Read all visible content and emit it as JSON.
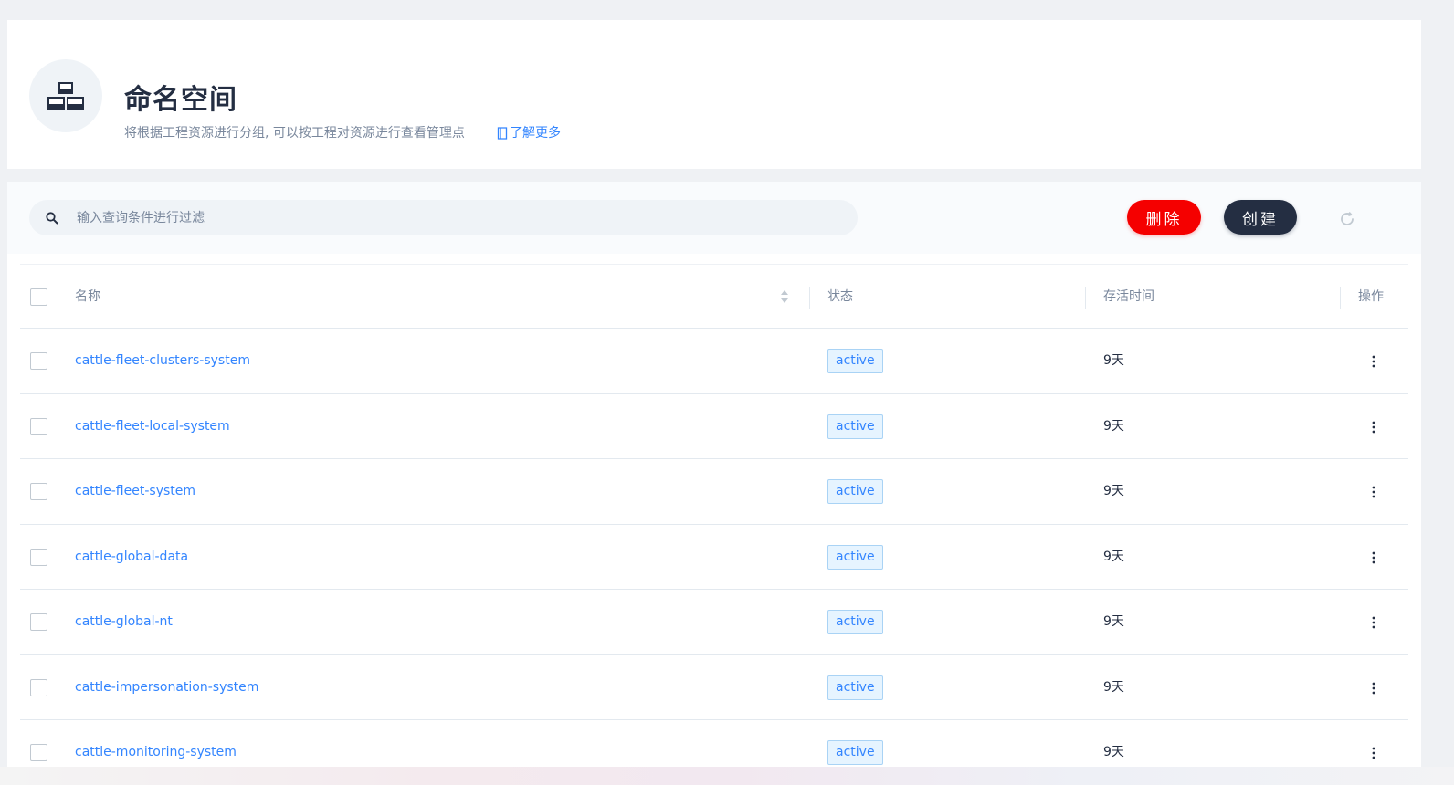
{
  "header": {
    "title": "命名空间",
    "description": "将根据工程资源进行分组, 可以按工程对资源进行查看管理点",
    "learn_more": "了解更多",
    "icon": "namespace-icon"
  },
  "toolbar": {
    "search_placeholder": "输入查询条件进行过滤",
    "delete_label": "删除",
    "create_label": "创建",
    "delete_color": "#f50000",
    "create_color": "#242e42"
  },
  "table": {
    "columns": {
      "name": "名称",
      "status": "状态",
      "age": "存活时间",
      "actions": "操作"
    },
    "rows": [
      {
        "name": "cattle-fleet-clusters-system",
        "status": "active",
        "age": "9天"
      },
      {
        "name": "cattle-fleet-local-system",
        "status": "active",
        "age": "9天"
      },
      {
        "name": "cattle-fleet-system",
        "status": "active",
        "age": "9天"
      },
      {
        "name": "cattle-global-data",
        "status": "active",
        "age": "9天"
      },
      {
        "name": "cattle-global-nt",
        "status": "active",
        "age": "9天"
      },
      {
        "name": "cattle-impersonation-system",
        "status": "active",
        "age": "9天"
      },
      {
        "name": "cattle-monitoring-system",
        "status": "active",
        "age": "9天"
      }
    ]
  }
}
